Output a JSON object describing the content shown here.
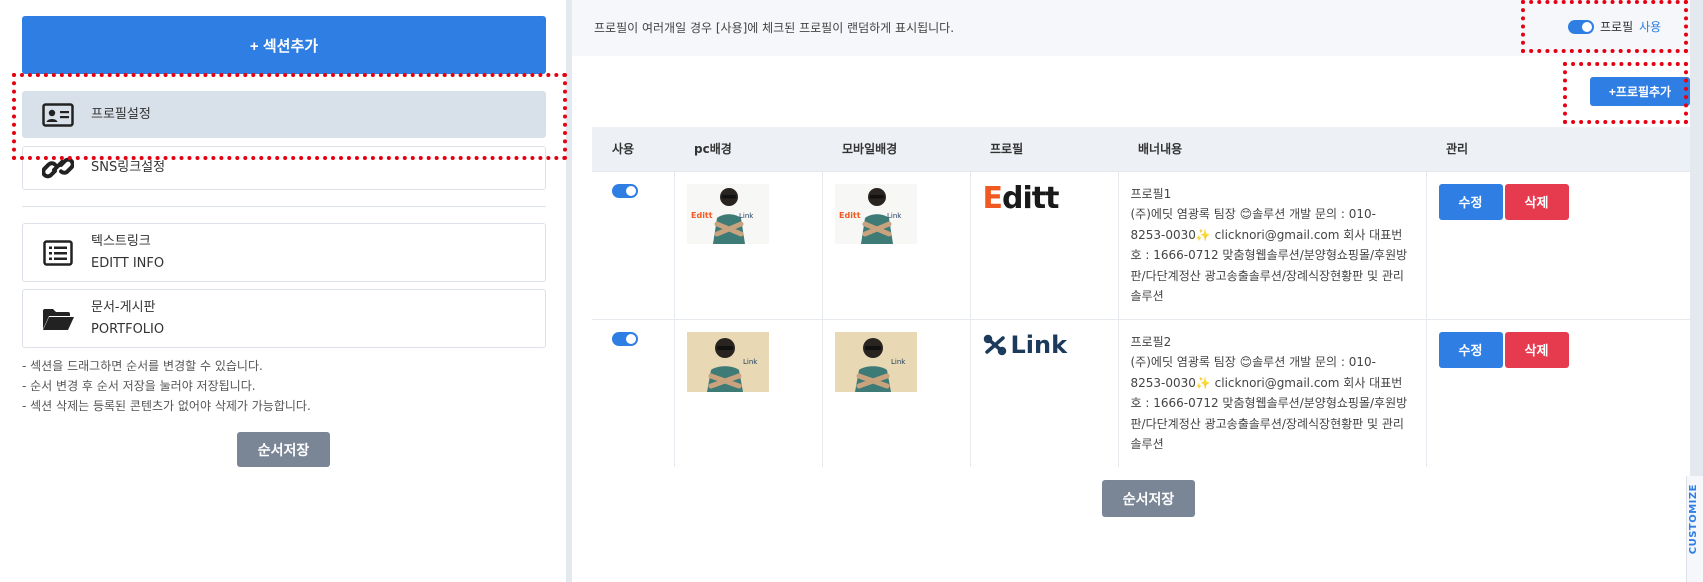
{
  "left": {
    "add_section_label": "+ 섹션추가",
    "sections": [
      {
        "label": "프로필설정",
        "sub": "",
        "icon": "id-card-icon",
        "active": true
      },
      {
        "label": "SNS링크설정",
        "sub": "",
        "icon": "link-icon",
        "active": false
      },
      {
        "label": "텍스트링크",
        "sub": "EDITT INFO",
        "icon": "list-icon",
        "active": false
      },
      {
        "label": "문서-게시판",
        "sub": "PORTFOLIO",
        "icon": "folder-icon",
        "active": false
      }
    ],
    "notes": [
      "- 섹션을 드래그하면 순서를 변경할 수 있습니다.",
      "- 순서 변경 후 순서 저장을 눌러야 저장됩니다.",
      "- 섹션 삭제는 등록된 콘텐츠가 없어야 삭제가 가능합니다."
    ],
    "save_label": "순서저장"
  },
  "right": {
    "notice": "프로필이 여러개일 경우 [사용]에 체크된 프로필이 랜덤하게 표시됩니다.",
    "profile_toggle_label": "프로필",
    "profile_toggle_state": "사용",
    "add_profile_label": "+프로필추가",
    "columns": [
      "사용",
      "pc배경",
      "모바일배경",
      "프로필",
      "배너내용",
      "관리"
    ],
    "rows": [
      {
        "enabled": true,
        "pc_bg": "character-thumbnail-white",
        "mobile_bg": "character-thumbnail-white",
        "profile_logo": "Editt",
        "banner_title": "프로필1",
        "banner_body": "(주)에딧 염광록 팀장 😊솔루션 개발 문의 : 010-8253-0030✨ clicknori@gmail.com 회사 대표번호 : 1666-0712 맞춤형웹솔루션/분양형쇼핑몰/후원방판/다단계정산 광고송출솔루션/장례식장현황판 및 관리 솔루션",
        "edit_label": "수정",
        "delete_label": "삭제"
      },
      {
        "enabled": true,
        "pc_bg": "character-thumbnail-beige",
        "mobile_bg": "character-thumbnail-beige",
        "profile_logo": "Link",
        "banner_title": "프로필2",
        "banner_body": "(주)에딧 염광록 팀장 😊솔루션 개발 문의 : 010-8253-0030✨ clicknori@gmail.com 회사 대표번호 : 1666-0712 맞춤형웹솔루션/분양형쇼핑몰/후원방판/다단계정산 광고송출솔루션/장례식장현황판 및 관리 솔루션",
        "edit_label": "수정",
        "delete_label": "삭제"
      }
    ],
    "save_label": "순서저장"
  },
  "thumb_text": {
    "editt": "Editt",
    "link": "Link"
  },
  "customize_tab": "CUSTOMIZE",
  "colors": {
    "primary": "#2f7ee3",
    "danger": "#e63b4f",
    "gray_button": "#7a8696",
    "highlight_dots": "#e60012"
  }
}
